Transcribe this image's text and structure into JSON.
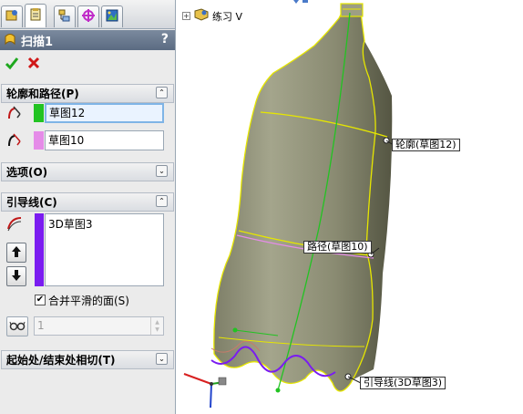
{
  "panel": {
    "title": "扫描1",
    "help": "?",
    "sections": {
      "profile_path": {
        "label": "轮廓和路径(P)",
        "profile_value": "草图12",
        "path_value": "草图10"
      },
      "options": {
        "label": "选项(O)"
      },
      "guides": {
        "label": "引导线(C)",
        "items": [
          "3D草图3"
        ],
        "merge_label": "合并平滑的面(S)",
        "merge_checked": "✔",
        "count_value": "1"
      },
      "tangency": {
        "label": "起始处/结束处相切(T)"
      }
    }
  },
  "viewport": {
    "tree_label": "练习 V",
    "callouts": {
      "profile": "轮廓(草图12)",
      "path": "路径(草图10)",
      "guide": "引导线(3D草图3)"
    },
    "colors": {
      "profile": "#22c322",
      "path": "#e58ce8",
      "guide": "#7a1cf0",
      "edge": "#e6e600",
      "body": "#9b9c80"
    }
  }
}
